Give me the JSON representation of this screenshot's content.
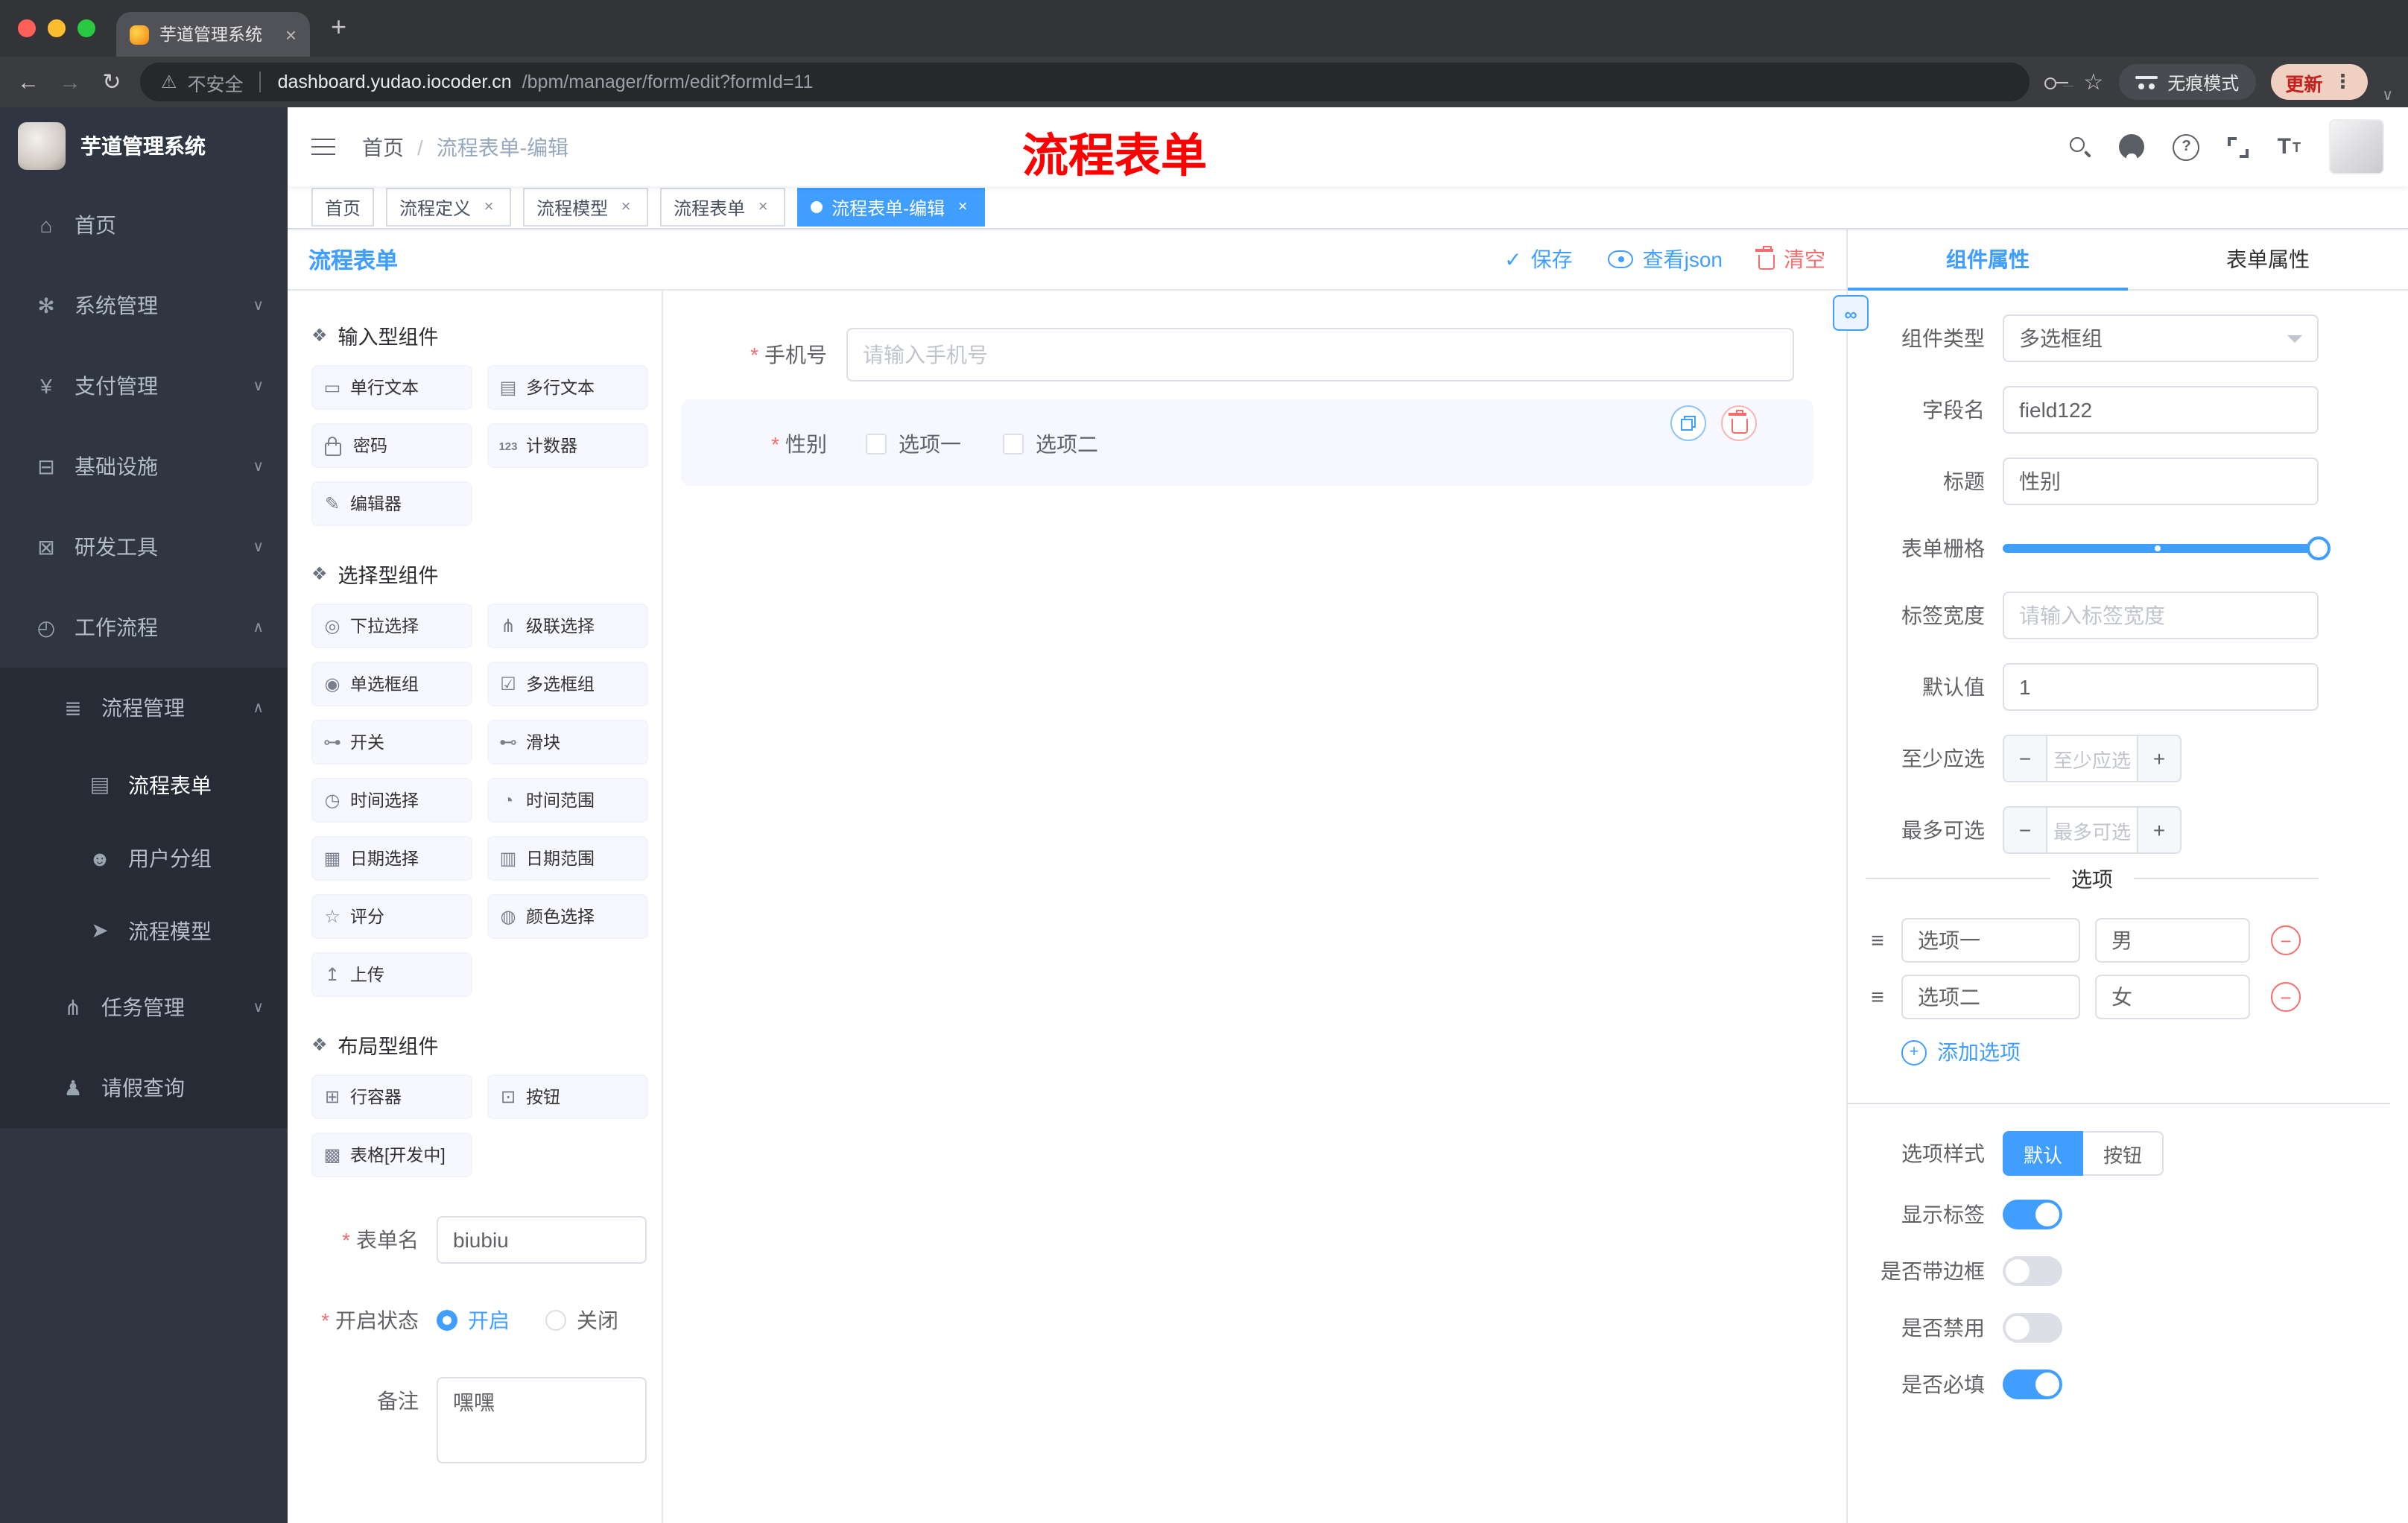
{
  "browser": {
    "tab_title": "芋道管理系统",
    "security_label": "不安全",
    "url_host": "dashboard.yudao.iocoder.cn",
    "url_path": "/bpm/manager/form/edit?formId=11",
    "incognito_label": "无痕模式",
    "update_label": "更新"
  },
  "sidebar": {
    "logo_title": "芋道管理系统",
    "items": [
      {
        "label": "首页",
        "icon": "home-icon",
        "level": 1
      },
      {
        "label": "系统管理",
        "icon": "gear-icon",
        "level": 1,
        "chevron": "down"
      },
      {
        "label": "支付管理",
        "icon": "yen-icon",
        "level": 1,
        "chevron": "down"
      },
      {
        "label": "基础设施",
        "icon": "infrastructure-icon",
        "level": 1,
        "chevron": "down"
      },
      {
        "label": "研发工具",
        "icon": "tools-icon",
        "level": 1,
        "chevron": "down"
      },
      {
        "label": "工作流程",
        "icon": "workflow-icon",
        "level": 1,
        "chevron": "up",
        "expanded": true
      },
      {
        "label": "流程管理",
        "icon": "process-icon",
        "level": 2,
        "chevron": "up",
        "expanded": true
      },
      {
        "label": "流程表单",
        "icon": "form-icon",
        "level": 3,
        "active": true
      },
      {
        "label": "用户分组",
        "icon": "users-icon",
        "level": 3
      },
      {
        "label": "流程模型",
        "icon": "model-icon",
        "level": 3
      },
      {
        "label": "任务管理",
        "icon": "tasks-icon",
        "level": 2,
        "chevron": "down"
      },
      {
        "label": "请假查询",
        "icon": "user-icon",
        "level": 2
      }
    ]
  },
  "header": {
    "breadcrumb": {
      "home": "首页",
      "separator": "/",
      "current": "流程表单-编辑"
    },
    "annotation": "流程表单"
  },
  "tags": [
    {
      "label": "首页",
      "closable": false,
      "active": false
    },
    {
      "label": "流程定义",
      "closable": true,
      "active": false
    },
    {
      "label": "流程模型",
      "closable": true,
      "active": false
    },
    {
      "label": "流程表单",
      "closable": true,
      "active": false
    },
    {
      "label": "流程表单-编辑",
      "closable": true,
      "active": true
    }
  ],
  "designer": {
    "title": "流程表单",
    "toolbar": {
      "save": "保存",
      "view_json": "查看json",
      "clear": "清空"
    },
    "palette": {
      "groups": [
        {
          "title": "输入型组件",
          "items": [
            {
              "label": "单行文本",
              "icon": "input"
            },
            {
              "label": "多行文本",
              "icon": "textarea"
            },
            {
              "label": "密码",
              "icon": "password"
            },
            {
              "label": "计数器",
              "icon": "counter"
            },
            {
              "label": "编辑器",
              "icon": "editor"
            }
          ]
        },
        {
          "title": "选择型组件",
          "items": [
            {
              "label": "下拉选择",
              "icon": "select"
            },
            {
              "label": "级联选择",
              "icon": "cascader"
            },
            {
              "label": "单选框组",
              "icon": "radio"
            },
            {
              "label": "多选框组",
              "icon": "checkbox"
            },
            {
              "label": "开关",
              "icon": "switch"
            },
            {
              "label": "滑块",
              "icon": "slider"
            },
            {
              "label": "时间选择",
              "icon": "time"
            },
            {
              "label": "时间范围",
              "icon": "time-range"
            },
            {
              "label": "日期选择",
              "icon": "date"
            },
            {
              "label": "日期范围",
              "icon": "date-range"
            },
            {
              "label": "评分",
              "icon": "rate"
            },
            {
              "label": "颜色选择",
              "icon": "color"
            },
            {
              "label": "上传",
              "icon": "upload"
            }
          ]
        },
        {
          "title": "布局型组件",
          "items": [
            {
              "label": "行容器",
              "icon": "row"
            },
            {
              "label": "按钮",
              "icon": "button"
            },
            {
              "label": "表格[开发中]",
              "icon": "table"
            }
          ]
        }
      ],
      "form": {
        "name_label": "表单名",
        "name_value": "biubiu",
        "status_label": "开启状态",
        "status_on": "开启",
        "status_off": "关闭",
        "status_value": "开启",
        "remark_label": "备注",
        "remark_value": "嘿嘿"
      }
    },
    "canvas": {
      "phone": {
        "label": "手机号",
        "required": true,
        "placeholder": "请输入手机号"
      },
      "gender": {
        "label": "性别",
        "required": true,
        "options": [
          "选项一",
          "选项二"
        ],
        "selected": true
      }
    },
    "props": {
      "tabs": {
        "component": "组件属性",
        "form": "表单属性"
      },
      "rows": {
        "type_label": "组件类型",
        "type_value": "多选框组",
        "field_label": "字段名",
        "field_value": "field122",
        "title_label": "标题",
        "title_value": "性别",
        "grid_label": "表单栅格",
        "width_label": "标签宽度",
        "width_placeholder": "请输入标签宽度",
        "default_label": "默认值",
        "default_value": "1",
        "min_label": "至少应选",
        "min_placeholder": "至少应选",
        "max_label": "最多可选",
        "max_placeholder": "最多可选"
      },
      "options_divider": "选项",
      "options": [
        {
          "label": "选项一",
          "value": "男"
        },
        {
          "label": "选项二",
          "value": "女"
        }
      ],
      "add_option": "添加选项",
      "style": {
        "label": "选项样式",
        "default": "默认",
        "button": "按钮",
        "active": "默认"
      },
      "switches": [
        {
          "label": "显示标签",
          "on": true
        },
        {
          "label": "是否带边框",
          "on": false
        },
        {
          "label": "是否禁用",
          "on": false
        },
        {
          "label": "是否必填",
          "on": true
        }
      ]
    }
  }
}
